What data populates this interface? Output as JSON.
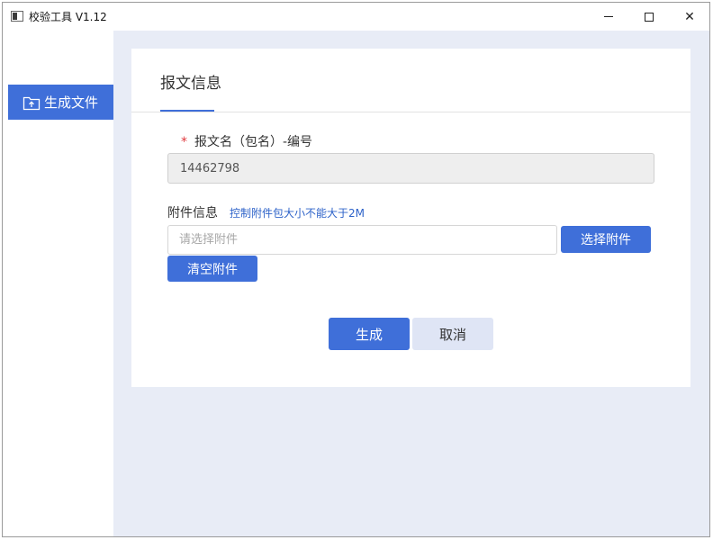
{
  "window": {
    "title": "校验工具 V1.12",
    "controls": {
      "minimize": "minimize-icon",
      "maximize": "maximize-icon",
      "close": "✕"
    }
  },
  "sidebar": {
    "items": [
      {
        "label": "生成文件",
        "icon": "folder-upload-icon",
        "active": true
      }
    ]
  },
  "form": {
    "title": "报文信息",
    "name_field": {
      "required_mark": "*",
      "label": "报文名（包名）-编号",
      "value": "14462798"
    },
    "attachment": {
      "label": "附件信息",
      "hint": "控制附件包大小不能大于2M",
      "placeholder": "请选择附件",
      "value": "",
      "choose_label": "选择附件",
      "clear_label": "清空附件"
    },
    "actions": {
      "generate_label": "生成",
      "cancel_label": "取消"
    }
  },
  "colors": {
    "primary": "#3f6fd9",
    "content_bg": "#e8ecf6",
    "required": "#e0393e",
    "hint": "#2e63c9",
    "cancel_bg": "#dfe5f5"
  }
}
